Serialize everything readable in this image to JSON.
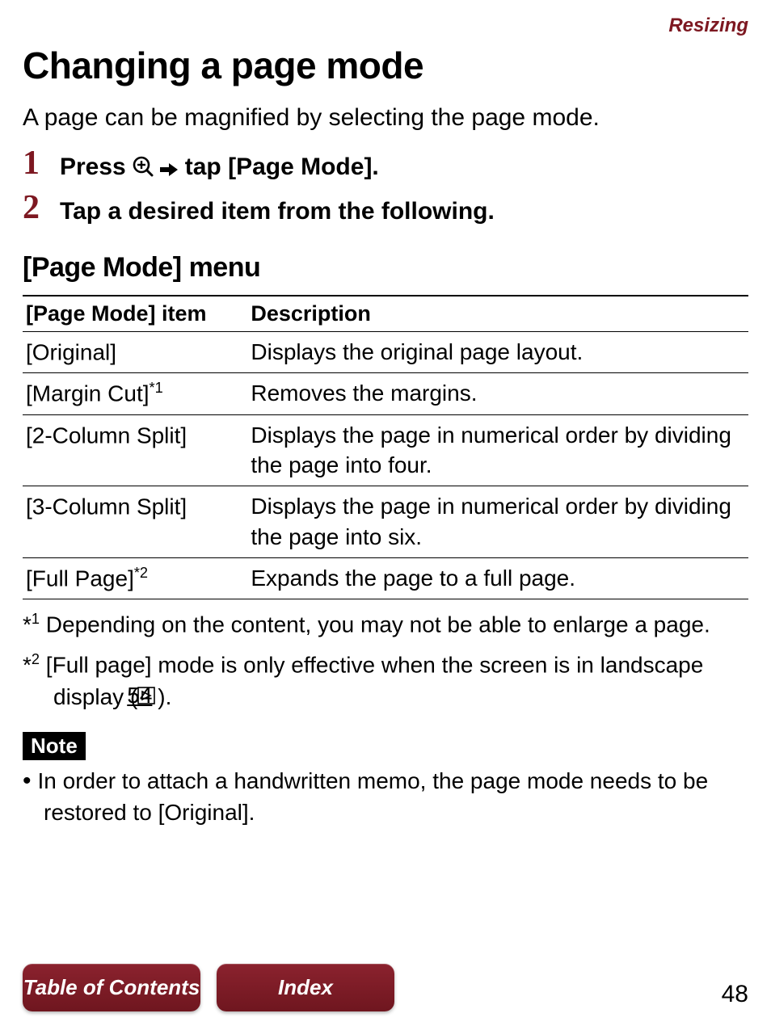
{
  "header": {
    "section_link": "Resizing",
    "title": "Changing a page mode",
    "intro": "A page can be magnified by selecting the page mode."
  },
  "steps": [
    {
      "num": "1",
      "before": "Press ",
      "after": " tap [Page Mode]."
    },
    {
      "num": "2",
      "text": "Tap a desired item from the following."
    }
  ],
  "menu": {
    "heading": "[Page Mode] menu",
    "columns": [
      "[Page Mode] item",
      "Description"
    ],
    "rows": [
      {
        "item": "[Original]",
        "sup": "",
        "desc": "Displays the original page layout."
      },
      {
        "item": "[Margin Cut]",
        "sup": "*1",
        "desc": "Removes the margins."
      },
      {
        "item": "[2-Column Split]",
        "sup": "",
        "desc": "Displays the page in numerical order by dividing the page into four."
      },
      {
        "item": "[3-Column Split]",
        "sup": "",
        "desc": "Displays the page in numerical order by dividing the page into six."
      },
      {
        "item": "[Full Page]",
        "sup": "*2",
        "desc": "Expands the page to a full page."
      }
    ]
  },
  "footnotes": [
    {
      "marker": "*",
      "sup": "1",
      "text": " Depending on the content, you may not be able to enlarge a page."
    },
    {
      "marker": "*",
      "sup": "2",
      "text_before": " [Full page] mode is only effective when the screen is in landscape display (",
      "pageref": "54",
      "text_after": ")."
    }
  ],
  "note": {
    "label": "Note",
    "bullet": "In order to attach a handwritten memo, the page mode needs to be restored to [Original]."
  },
  "footer": {
    "toc": "Table of Contents",
    "index": "Index",
    "page": "48"
  }
}
